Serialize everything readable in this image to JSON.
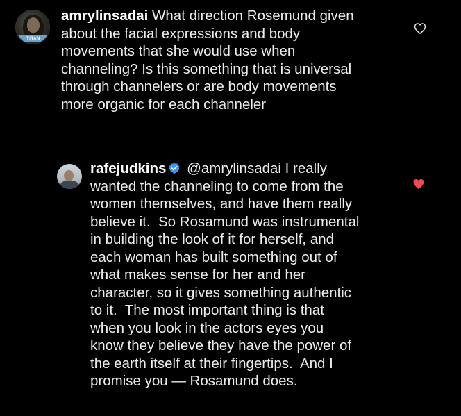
{
  "comment": {
    "username": "amrylinsadai",
    "lines": [
      " What direction Rosemund given",
      "about the facial expressions and body",
      "movements that she would use when",
      "channeling? Is this something that is universal",
      "through channelers or are body movements",
      "more organic for each channeler"
    ],
    "avatar_badge": "TITAN",
    "like_icon": "heart-outline-icon"
  },
  "reply": {
    "username": "rafejudkins",
    "verified_icon": "verified-badge-icon",
    "lines": [
      " @amrylinsadai I really",
      "wanted the channeling to come from the",
      "women themselves, and have them really",
      "believe it.  So Rosamund was instrumental",
      "in building the look of it for herself, and",
      "each woman has built something out of",
      "what makes sense for her and her",
      "character, so it gives something authentic",
      "to it.  The most important thing is that",
      "when you look in the actors eyes you",
      "know they believe they have the power of",
      "the earth itself at their fingertips.  And I",
      "promise you — Rosamund does."
    ],
    "like_icon": "heart-filled-icon"
  },
  "colors": {
    "background": "#000000",
    "text": "#ececec",
    "verified_blue": "#3897f0",
    "liked_red": "#ed4956"
  }
}
